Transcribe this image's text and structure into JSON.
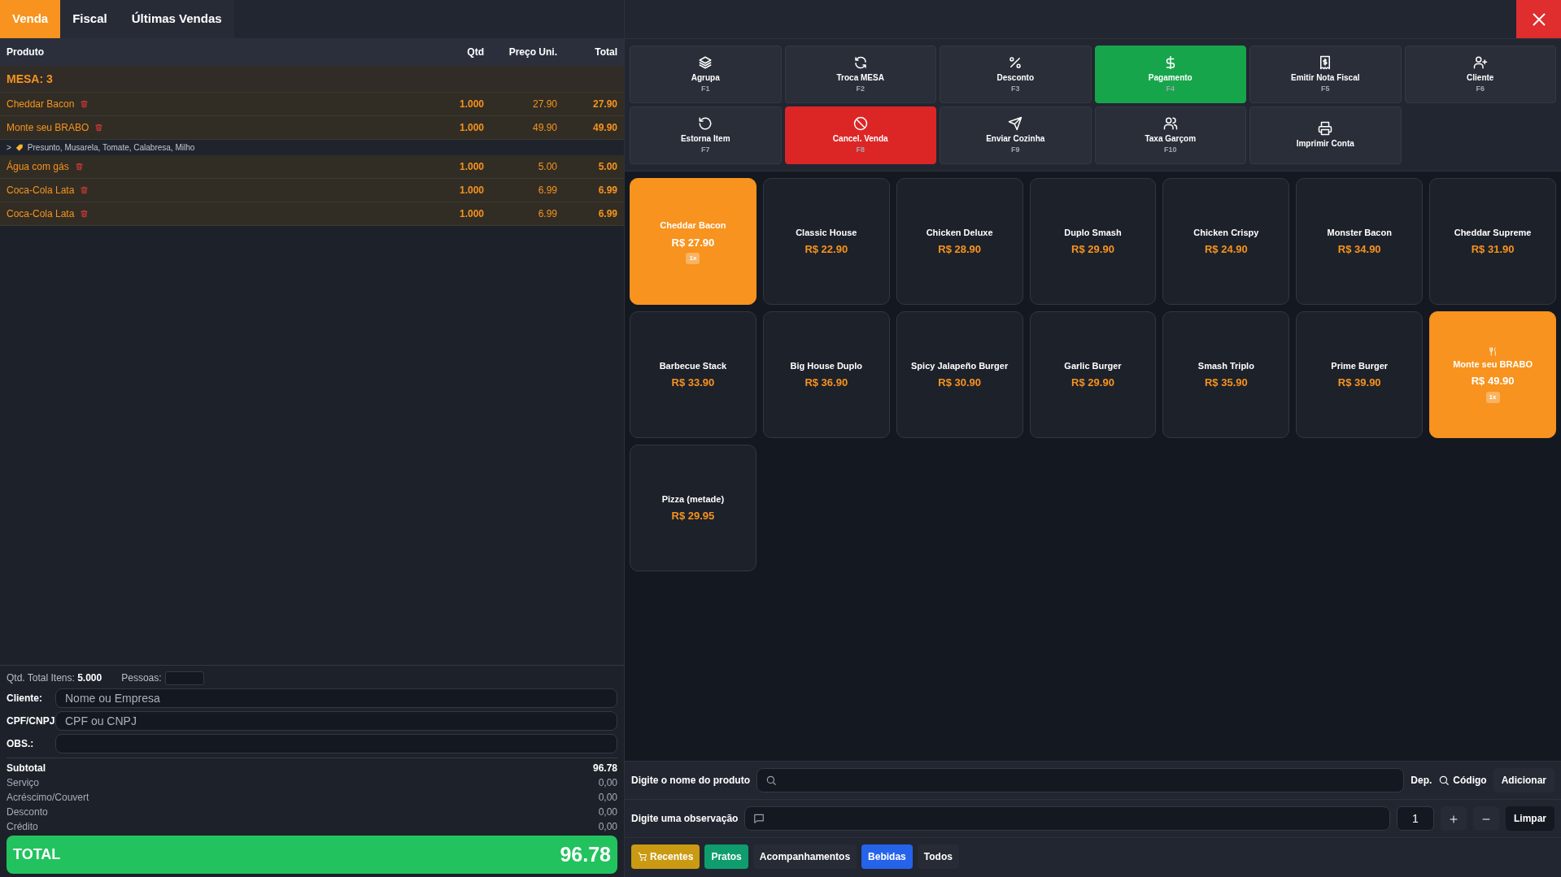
{
  "tabs": [
    {
      "label": "Venda",
      "selected": true
    },
    {
      "label": "Fiscal",
      "selected": false
    },
    {
      "label": "Últimas Vendas",
      "selected": false
    }
  ],
  "table": {
    "columns": [
      "Produto",
      "Qtd",
      "Preço Uni.",
      "Total"
    ],
    "group": "MESA: 3",
    "rows": [
      {
        "kind": "item",
        "product": "Cheddar Bacon",
        "qty": "1.000",
        "price": "27.90",
        "total": "27.90"
      },
      {
        "kind": "item",
        "product": "Monte seu BRABO",
        "qty": "1.000",
        "price": "49.90",
        "total": "49.90"
      },
      {
        "kind": "note",
        "prefix": ">",
        "text": "Presunto, Musarela, Tomate, Calabresa, Milho"
      },
      {
        "kind": "item",
        "product": "Água com gás",
        "qty": "1.000",
        "price": "5.00",
        "total": "5.00"
      },
      {
        "kind": "item",
        "product": "Coca-Cola Lata",
        "qty": "1.000",
        "price": "6.99",
        "total": "6.99"
      },
      {
        "kind": "item",
        "product": "Coca-Cola Lata",
        "qty": "1.000",
        "price": "6.99",
        "total": "6.99"
      }
    ]
  },
  "summary": {
    "items_label": "Qtd. Total Itens:",
    "items_value": "5.000",
    "people_label": "Pessoas:"
  },
  "fields": [
    {
      "label": "Cliente:",
      "placeholder": "Nome ou Empresa"
    },
    {
      "label": "CPF/CNPJ",
      "placeholder": "CPF ou CNPJ"
    },
    {
      "label": "OBS.:"
    }
  ],
  "totals": [
    {
      "kind": "subtotal",
      "label": "Subtotal",
      "value": "96.78"
    },
    {
      "kind": "line",
      "label": "Serviço",
      "value": "0,00"
    },
    {
      "kind": "line",
      "label": "Acréscimo/Couvert",
      "value": "0,00"
    },
    {
      "kind": "line",
      "label": "Desconto",
      "value": "0,00"
    },
    {
      "kind": "line",
      "label": "Crédito",
      "value": "0,00"
    }
  ],
  "total": {
    "label": "TOTAL",
    "value": "96.78"
  },
  "actions": [
    {
      "label": "Agrupa",
      "key": "F1",
      "kind": "default"
    },
    {
      "label": "Troca MESA",
      "key": "F2",
      "kind": "default"
    },
    {
      "label": "Desconto",
      "key": "F3",
      "kind": "default"
    },
    {
      "label": "Pagamento",
      "key": "F4",
      "kind": "success"
    },
    {
      "label": "Emitir Nota Fiscal",
      "key": "F5",
      "kind": "default"
    },
    {
      "label": "Cliente",
      "key": "F6",
      "kind": "default"
    },
    {
      "label": "Estorna Item",
      "key": "F7",
      "kind": "default"
    },
    {
      "label": "Cancel. Venda",
      "key": "F8",
      "kind": "danger"
    },
    {
      "label": "Enviar Cozinha",
      "key": "F9",
      "kind": "default"
    },
    {
      "label": "Taxa Garçom",
      "key": "F10",
      "kind": "default"
    },
    {
      "label": "Imprimir Conta",
      "kind": "default"
    }
  ],
  "products": [
    {
      "name": "Cheddar Bacon",
      "price": "R$ 27.90",
      "selected": true,
      "count": "1x"
    },
    {
      "name": "Classic House",
      "price": "R$ 22.90",
      "selected": false
    },
    {
      "name": "Chicken Deluxe",
      "price": "R$ 28.90",
      "selected": false
    },
    {
      "name": "Duplo Smash",
      "price": "R$ 29.90",
      "selected": false
    },
    {
      "name": "Chicken Crispy",
      "price": "R$ 24.90",
      "selected": false
    },
    {
      "name": "Monster Bacon",
      "price": "R$ 34.90",
      "selected": false
    },
    {
      "name": "Cheddar Supreme",
      "price": "R$ 31.90",
      "selected": false
    },
    {
      "name": "Barbecue Stack",
      "price": "R$ 33.90",
      "selected": false
    },
    {
      "name": "Big House Duplo",
      "price": "R$ 36.90",
      "selected": false
    },
    {
      "name": "Spicy Jalapeño Burger",
      "price": "R$ 30.90",
      "selected": false
    },
    {
      "name": "Garlic Burger",
      "price": "R$ 29.90",
      "selected": false
    },
    {
      "name": "Smash Triplo",
      "price": "R$ 35.90",
      "selected": false
    },
    {
      "name": "Prime Burger",
      "price": "R$ 39.90",
      "selected": false
    },
    {
      "name": "Monte seu BRABO",
      "price": "R$ 49.90",
      "selected": true,
      "count": "1x",
      "kind": "custom"
    },
    {
      "name": "Pizza (metade)",
      "price": "R$ 29.95",
      "selected": false
    }
  ],
  "search": {
    "label": "Digite o nome do produto",
    "dep": "Dep.",
    "code": "Código",
    "add": "Adicionar"
  },
  "observation": {
    "label": "Digite uma observação",
    "qty": "1",
    "clear": "Limpar"
  },
  "categories": [
    {
      "label": "Recentes",
      "color": "#ca9a12",
      "kind": "recent"
    },
    {
      "label": "Pratos",
      "color": "#0f9d6e"
    },
    {
      "label": "Acompanhamentos",
      "color": "#262b35"
    },
    {
      "label": "Bebidas",
      "color": "#2563eb"
    },
    {
      "label": "Todos",
      "color": "#262b35"
    }
  ]
}
